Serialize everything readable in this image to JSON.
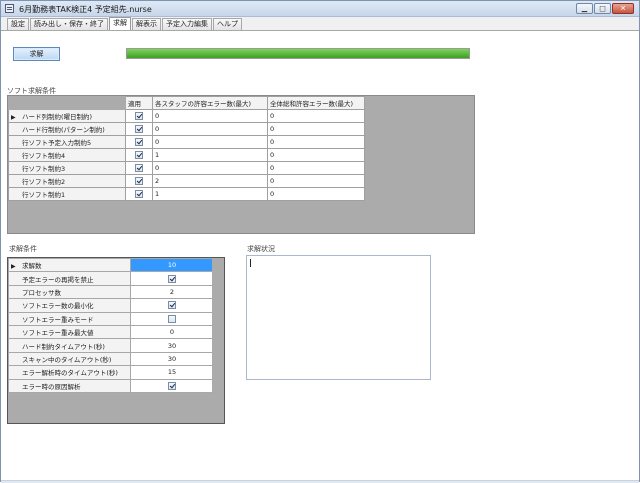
{
  "window": {
    "title": "6月勤務表TAK検正4 予定組先.nurse"
  },
  "tabs": [
    {
      "label": "設定",
      "active": false
    },
    {
      "label": "読み出し・保存・終了",
      "active": false
    },
    {
      "label": "求解",
      "active": true
    },
    {
      "label": "解表示",
      "active": false
    },
    {
      "label": "予定入力編集",
      "active": false
    },
    {
      "label": "ヘルプ",
      "active": false
    }
  ],
  "solve": {
    "button_label": "求解",
    "progress_fraction": 1.0
  },
  "soft_conditions": {
    "section_label": "ソフト求解条件",
    "headers": {
      "apply": "適用",
      "per_staff": "各スタッフの許容エラー数(最大)",
      "total": "全体総和許容エラー数(最大)"
    },
    "rows": [
      {
        "name": "ハード列制約(曜日制約)",
        "apply": true,
        "per_staff": "0",
        "total": "0",
        "current": true
      },
      {
        "name": "ハード行制約(パターン制約)",
        "apply": true,
        "per_staff": "0",
        "total": "0",
        "current": false
      },
      {
        "name": "行ソフト予定入力制約5",
        "apply": true,
        "per_staff": "0",
        "total": "0",
        "current": false
      },
      {
        "name": "行ソフト制約4",
        "apply": true,
        "per_staff": "1",
        "total": "0",
        "current": false
      },
      {
        "name": "行ソフト制約3",
        "apply": true,
        "per_staff": "0",
        "total": "0",
        "current": false
      },
      {
        "name": "行ソフト制約2",
        "apply": true,
        "per_staff": "2",
        "total": "0",
        "current": false
      },
      {
        "name": "行ソフト制約1",
        "apply": true,
        "per_staff": "1",
        "total": "0",
        "current": false
      }
    ]
  },
  "solve_conditions": {
    "section_label": "求解条件",
    "rows": [
      {
        "name": "求解数",
        "kind": "text",
        "value": "10",
        "current": true,
        "selected": true
      },
      {
        "name": "予定エラーの再掲を禁止",
        "kind": "check",
        "checked": true
      },
      {
        "name": "プロセッサ数",
        "kind": "text",
        "value": "2"
      },
      {
        "name": "ソフトエラー数の最小化",
        "kind": "check",
        "checked": true
      },
      {
        "name": "ソフトエラー重みモード",
        "kind": "check",
        "checked": false
      },
      {
        "name": "ソフトエラー重み最大値",
        "kind": "text",
        "value": "0"
      },
      {
        "name": "ハード制約タイムアウト(秒)",
        "kind": "text",
        "value": "30"
      },
      {
        "name": "スキャン中のタイムアウト(秒)",
        "kind": "text",
        "value": "30"
      },
      {
        "name": "エラー解析時のタイムアウト(秒)",
        "kind": "text",
        "value": "15"
      },
      {
        "name": "エラー時の原因解析",
        "kind": "check",
        "checked": true
      }
    ]
  },
  "status": {
    "section_label": "求解状況",
    "text": ""
  }
}
